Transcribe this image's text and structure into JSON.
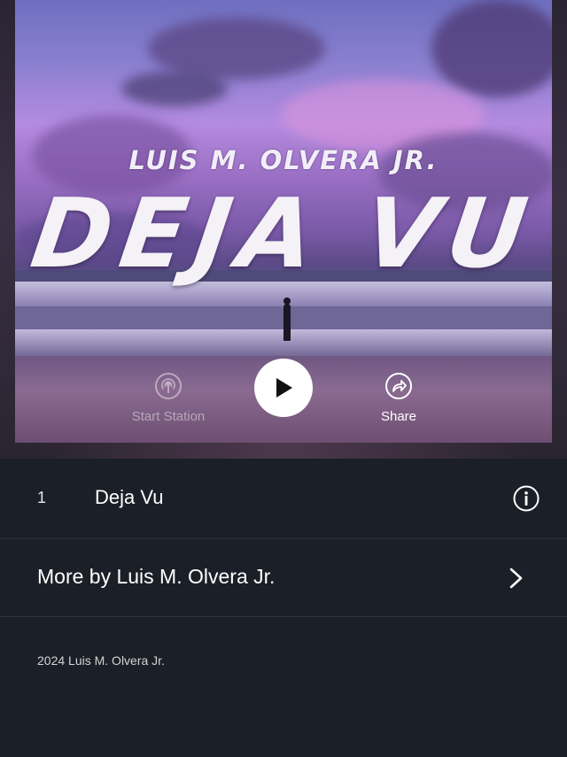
{
  "album": {
    "art_artist_text": "LUIS M. OLVERA JR.",
    "art_title_text": "DEJA VU"
  },
  "controls": {
    "start_station_label": "Start Station",
    "share_label": "Share",
    "play_icon": "play-icon",
    "station_icon": "radio-station-icon",
    "share_icon": "share-arrow-icon"
  },
  "tracks": [
    {
      "number": "1",
      "title": "Deja Vu"
    }
  ],
  "more_by": {
    "label": "More by Luis M. Olvera Jr."
  },
  "footer": {
    "copyright": "2024 Luis M. Olvera Jr."
  },
  "colors": {
    "background": "#1b1f27",
    "divider": "#2c313a",
    "text": "#ffffff"
  }
}
